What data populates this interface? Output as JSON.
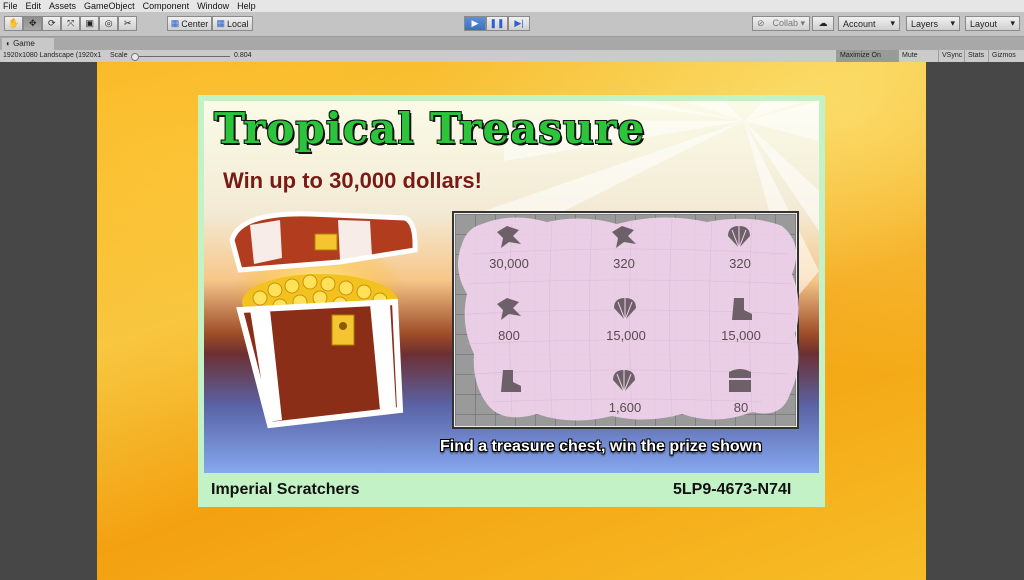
{
  "menu": [
    "File",
    "Edit",
    "Assets",
    "GameObject",
    "Component",
    "Window",
    "Help"
  ],
  "toolbar": {
    "center_label": "Center",
    "local_label": "Local",
    "collab_label": "Collab ▾",
    "account_label": "Account",
    "layers_label": "Layers",
    "layout_label": "Layout"
  },
  "game_tab": {
    "label": "Game"
  },
  "game_bar": {
    "resolution": "1920x1080 Landscape (1920x1",
    "scale_label": "Scale",
    "scale_value": "0.804",
    "scale_fraction": 0.0,
    "maximize": "Maximize On Play",
    "mute": "Mute Audio",
    "vsync": "VSync",
    "stats": "Stats",
    "gizmos": "Gizmos"
  },
  "ticket": {
    "title": "Tropical Treasure",
    "subtitle": "Win up to 30,000 dollars!",
    "caption": "Find a treasure chest, win the prize shown",
    "brand": "Imperial Scratchers",
    "serial": "5LP9-4673-N74I",
    "cells": [
      {
        "icon": "fish-icon",
        "value": "30,000"
      },
      {
        "icon": "fish-icon",
        "value": "320"
      },
      {
        "icon": "shell-icon",
        "value": "320"
      },
      {
        "icon": "fish-icon",
        "value": "800"
      },
      {
        "icon": "shell-icon",
        "value": "15,000"
      },
      {
        "icon": "boot-icon",
        "value": "15,000"
      },
      {
        "icon": "boot-icon",
        "value": ""
      },
      {
        "icon": "shell-icon",
        "value": "1,600"
      },
      {
        "icon": "chest-icon",
        "value": "80"
      }
    ]
  },
  "colors": {
    "title_green": "#2bc43a",
    "subtitle_red": "#7a1a12",
    "ticket_border": "#c3f2c6",
    "scratch_pink": "#f0d2ec",
    "background_orange": "#f6b823"
  }
}
